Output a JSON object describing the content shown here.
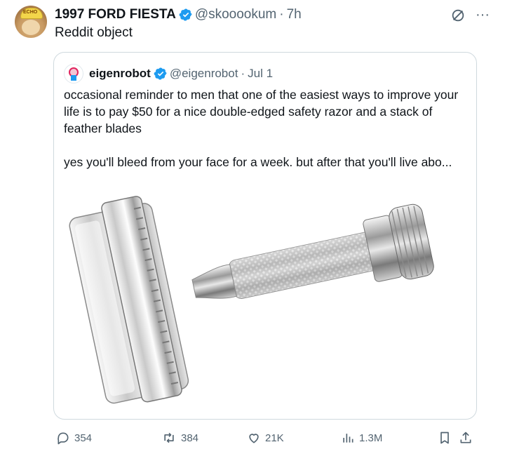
{
  "tweet": {
    "display_name": "1997 FORD FIESTA",
    "handle": "@skooookum",
    "time_sep": "·",
    "time": "7h",
    "text": "Reddit object",
    "avatar_hat_text": "ECHO"
  },
  "quoted": {
    "display_name": "eigenrobot",
    "handle": "@eigenrobot",
    "time_sep": "·",
    "date": "Jul 1",
    "paragraph1": "occasional reminder to men that one of the easiest ways to improve your life is to pay $50 for a nice double-edged safety razor and a stack of feather blades",
    "paragraph2": "yes you'll bleed from your face for a week. but after that you'll live abo..."
  },
  "stats": {
    "replies": "354",
    "reposts": "384",
    "likes": "21K",
    "views": "1.3M"
  },
  "colors": {
    "verified": "#1d9bf0",
    "muted": "#536471",
    "border": "#cfd9de"
  }
}
